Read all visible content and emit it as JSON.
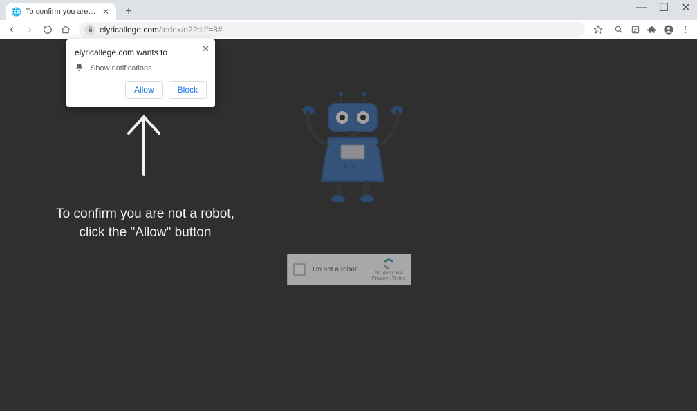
{
  "window": {
    "minimize": "—",
    "maximize": "☐",
    "close": "✕"
  },
  "tab": {
    "title": "To confirm you are not a robot, c",
    "close": "✕"
  },
  "toolbar": {
    "newtab_plus": "+",
    "url_domain": "elyricallege.com",
    "url_path": "/index/n2?diff=8#"
  },
  "notif": {
    "head": "elyricallege.com wants to",
    "body": "Show notifications",
    "allow": "Allow",
    "block": "Block",
    "close": "✕"
  },
  "instruction": {
    "line1": "To confirm you are not a robot,",
    "line2": "click the \"Allow\" button"
  },
  "captcha": {
    "label": "I'm not a robot",
    "brand": "reCAPTCHA",
    "legal": "Privacy · Terms"
  }
}
